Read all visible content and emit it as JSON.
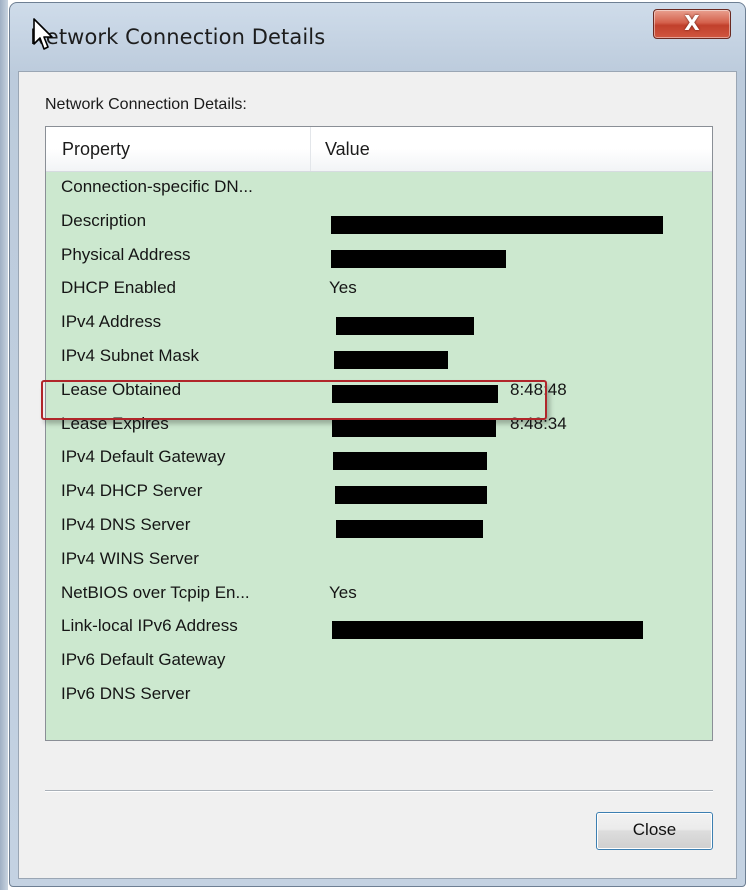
{
  "window": {
    "title": "Network Connection Details",
    "close_glyph": "X"
  },
  "group_label": "Network Connection Details:",
  "columns": {
    "property": "Property",
    "value": "Value"
  },
  "rows": [
    {
      "property": "Connection-specific DN...",
      "value": ""
    },
    {
      "property": "Description",
      "value": ""
    },
    {
      "property": "Physical Address",
      "value": ""
    },
    {
      "property": "DHCP Enabled",
      "value": "Yes"
    },
    {
      "property": "IPv4 Address",
      "value": ""
    },
    {
      "property": "IPv4 Subnet Mask",
      "value": ""
    },
    {
      "property": "Lease Obtained",
      "value": "8:48:48"
    },
    {
      "property": "Lease Expires",
      "value": "8:48:34"
    },
    {
      "property": "IPv4 Default Gateway",
      "value": ""
    },
    {
      "property": "IPv4 DHCP Server",
      "value": ""
    },
    {
      "property": "IPv4 DNS Server",
      "value": ""
    },
    {
      "property": "IPv4 WINS Server",
      "value": ""
    },
    {
      "property": "NetBIOS over Tcpip En...",
      "value": "Yes"
    },
    {
      "property": "Link-local IPv6 Address",
      "value": ""
    },
    {
      "property": "IPv6 Default Gateway",
      "value": ""
    },
    {
      "property": "IPv6 DNS Server",
      "value": ""
    }
  ],
  "buttons": {
    "close": "Close"
  },
  "colors": {
    "list_background": "#cce8cf",
    "highlight_border": "#b0262a",
    "redaction": "#000000"
  },
  "icons": [
    "close-icon",
    "mouse-cursor-icon"
  ]
}
